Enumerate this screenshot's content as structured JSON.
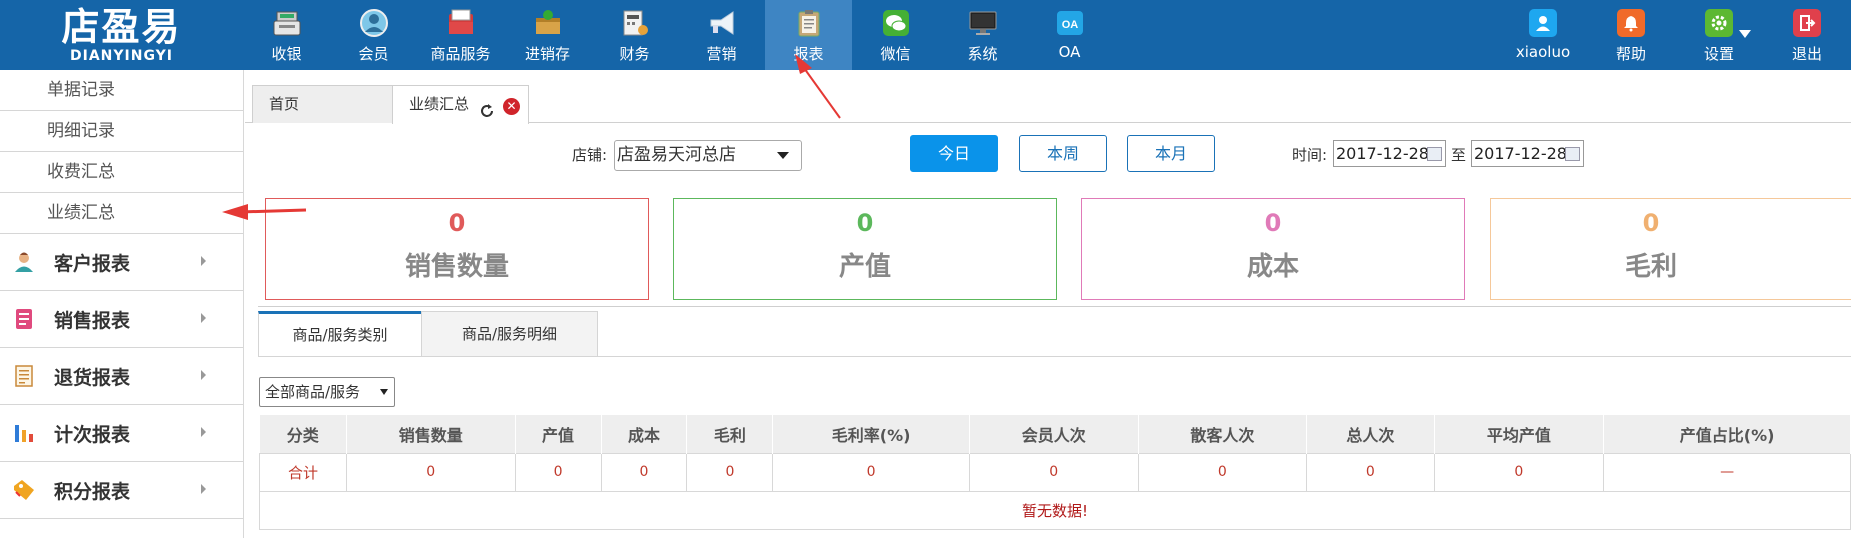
{
  "app": {
    "logo_cn": "店盈易",
    "logo_en": "DIANYINGYI"
  },
  "nav": [
    {
      "label": "收银",
      "icon": "cash-register-icon"
    },
    {
      "label": "会员",
      "icon": "member-icon"
    },
    {
      "label": "商品服务",
      "icon": "goods-service-icon"
    },
    {
      "label": "进销存",
      "icon": "inventory-icon"
    },
    {
      "label": "财务",
      "icon": "finance-icon"
    },
    {
      "label": "营销",
      "icon": "megaphone-icon"
    },
    {
      "label": "报表",
      "icon": "report-icon",
      "active": true
    },
    {
      "label": "微信",
      "icon": "wechat-icon"
    },
    {
      "label": "系统",
      "icon": "monitor-icon"
    },
    {
      "label": "OA",
      "icon": "oa-icon"
    }
  ],
  "right_nav": {
    "user": {
      "label": "xiaoluo",
      "icon": "user-icon",
      "color": "#1ea7f0"
    },
    "help": {
      "label": "帮助",
      "icon": "bell-icon",
      "color": "#f06a2a"
    },
    "settings": {
      "label": "设置",
      "icon": "gear-icon",
      "color": "#5cb832"
    },
    "logout": {
      "label": "退出",
      "icon": "logout-icon",
      "color": "#e0404c"
    }
  },
  "sidebar": {
    "sub_items": [
      "单据记录",
      "明细记录",
      "收费汇总",
      "业绩汇总"
    ],
    "groups": [
      {
        "label": "客户报表",
        "icon": "customer-icon"
      },
      {
        "label": "销售报表",
        "icon": "sales-report-icon"
      },
      {
        "label": "退货报表",
        "icon": "return-report-icon"
      },
      {
        "label": "计次报表",
        "icon": "bar-chart-icon"
      },
      {
        "label": "积分报表",
        "icon": "points-tag-icon"
      }
    ]
  },
  "tabs": {
    "home": "首页",
    "current": "业绩汇总"
  },
  "filters": {
    "store_label": "店铺:",
    "store_value": "店盈易天河总店",
    "periods": [
      "今日",
      "本周",
      "本月"
    ],
    "active_period": "今日",
    "time_label": "时间:",
    "date_from": "2017-12-28",
    "to_label": "至",
    "date_to": "2017-12-28"
  },
  "stats": [
    {
      "value": "0",
      "label": "销售数量",
      "color": "#e05a5a"
    },
    {
      "value": "0",
      "label": "产值",
      "color": "#5cb85c"
    },
    {
      "value": "0",
      "label": "成本",
      "color": "#e07ab8"
    },
    {
      "value": "0",
      "label": "毛利",
      "color": "#f0b070"
    }
  ],
  "subtabs": [
    "商品/服务类别",
    "商品/服务明细"
  ],
  "category_select": "全部商品/服务",
  "table": {
    "headers": [
      "分类",
      "销售数量",
      "产值",
      "成本",
      "毛利",
      "毛利率(%)",
      "会员人次",
      "散客人次",
      "总人次",
      "平均产值",
      "产值占比(%)"
    ],
    "total_row": [
      "合计",
      "0",
      "0",
      "0",
      "0",
      "0",
      "0",
      "0",
      "0",
      "0",
      "—"
    ],
    "empty_text": "暂无数据!"
  }
}
